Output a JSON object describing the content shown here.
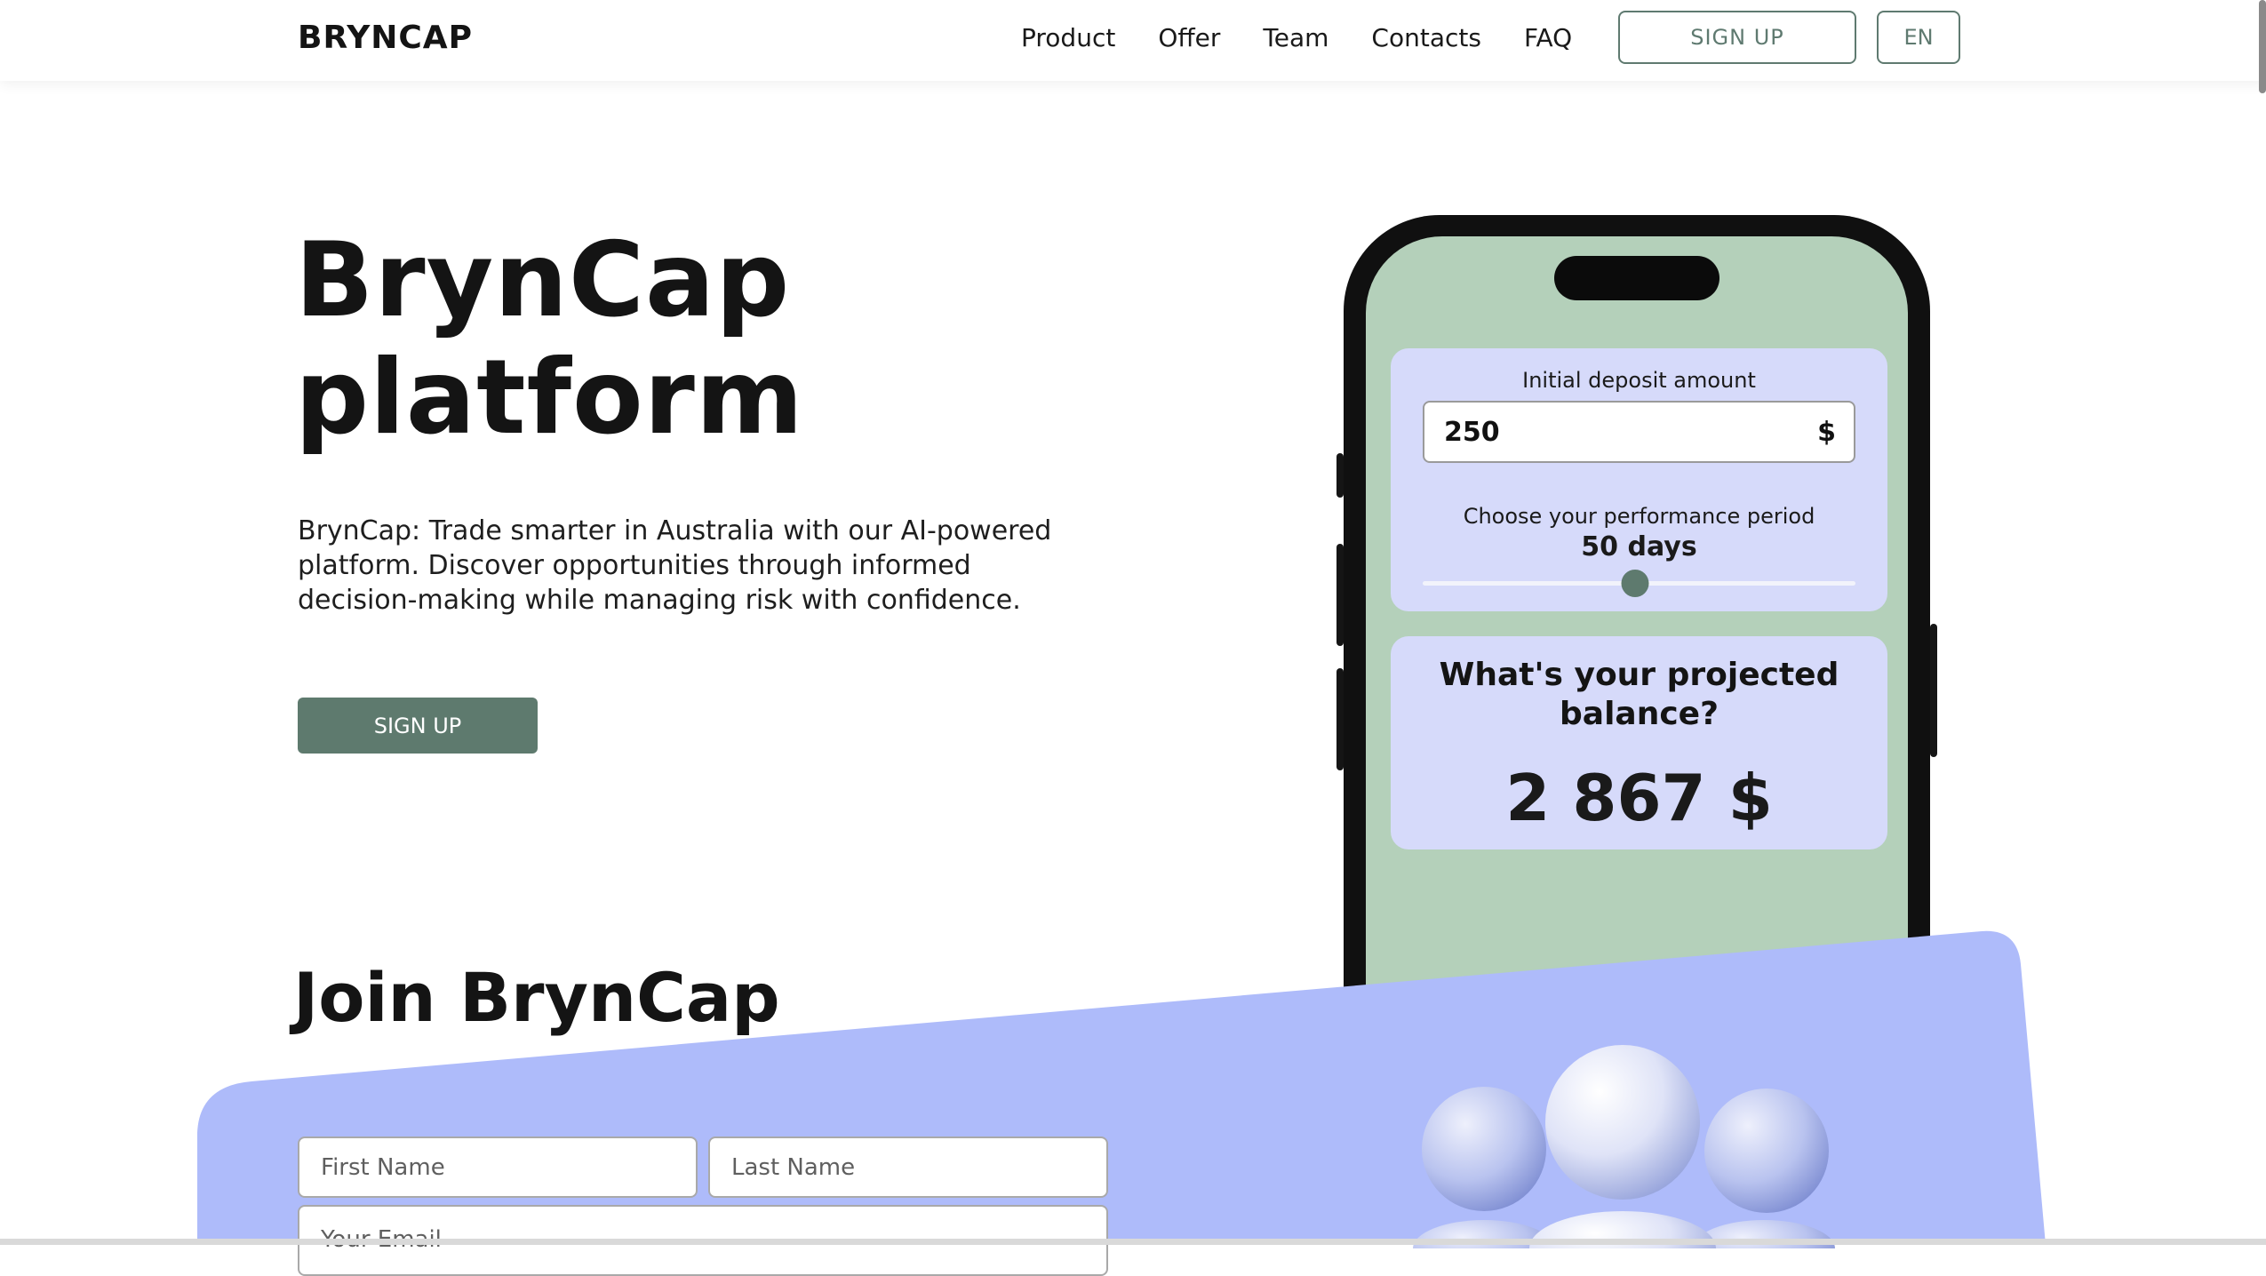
{
  "header": {
    "logo": "BRYNCAP",
    "nav": [
      "Product",
      "Offer",
      "Team",
      "Contacts",
      "FAQ"
    ],
    "signup_label": "SIGN UP",
    "language": "EN"
  },
  "hero": {
    "title_line1": "BrynCap",
    "title_line2": "platform",
    "description": "BrynCap: Trade smarter in Australia with our AI-powered platform. Discover opportunities through informed decision-making while managing risk with confidence.",
    "signup_label": "SIGN UP"
  },
  "calculator": {
    "deposit_label": "Initial deposit amount",
    "deposit_value": "250",
    "currency": "$",
    "period_label": "Choose your performance period",
    "period_value": "50 days",
    "slider_fraction": 0.49,
    "projected_title": "What's your projected balance?",
    "projected_value": "2 867 $"
  },
  "join": {
    "title": "Join BrynCap",
    "first_name_placeholder": "First Name",
    "last_name_placeholder": "Last Name",
    "email_placeholder": "Your Email"
  },
  "colors": {
    "accent": "#5e7a6e",
    "phone_screen": "#b4d0ba",
    "card": "#d6dafa",
    "band": "#aebbfa"
  },
  "icons": [
    "people-illustration-icon"
  ]
}
